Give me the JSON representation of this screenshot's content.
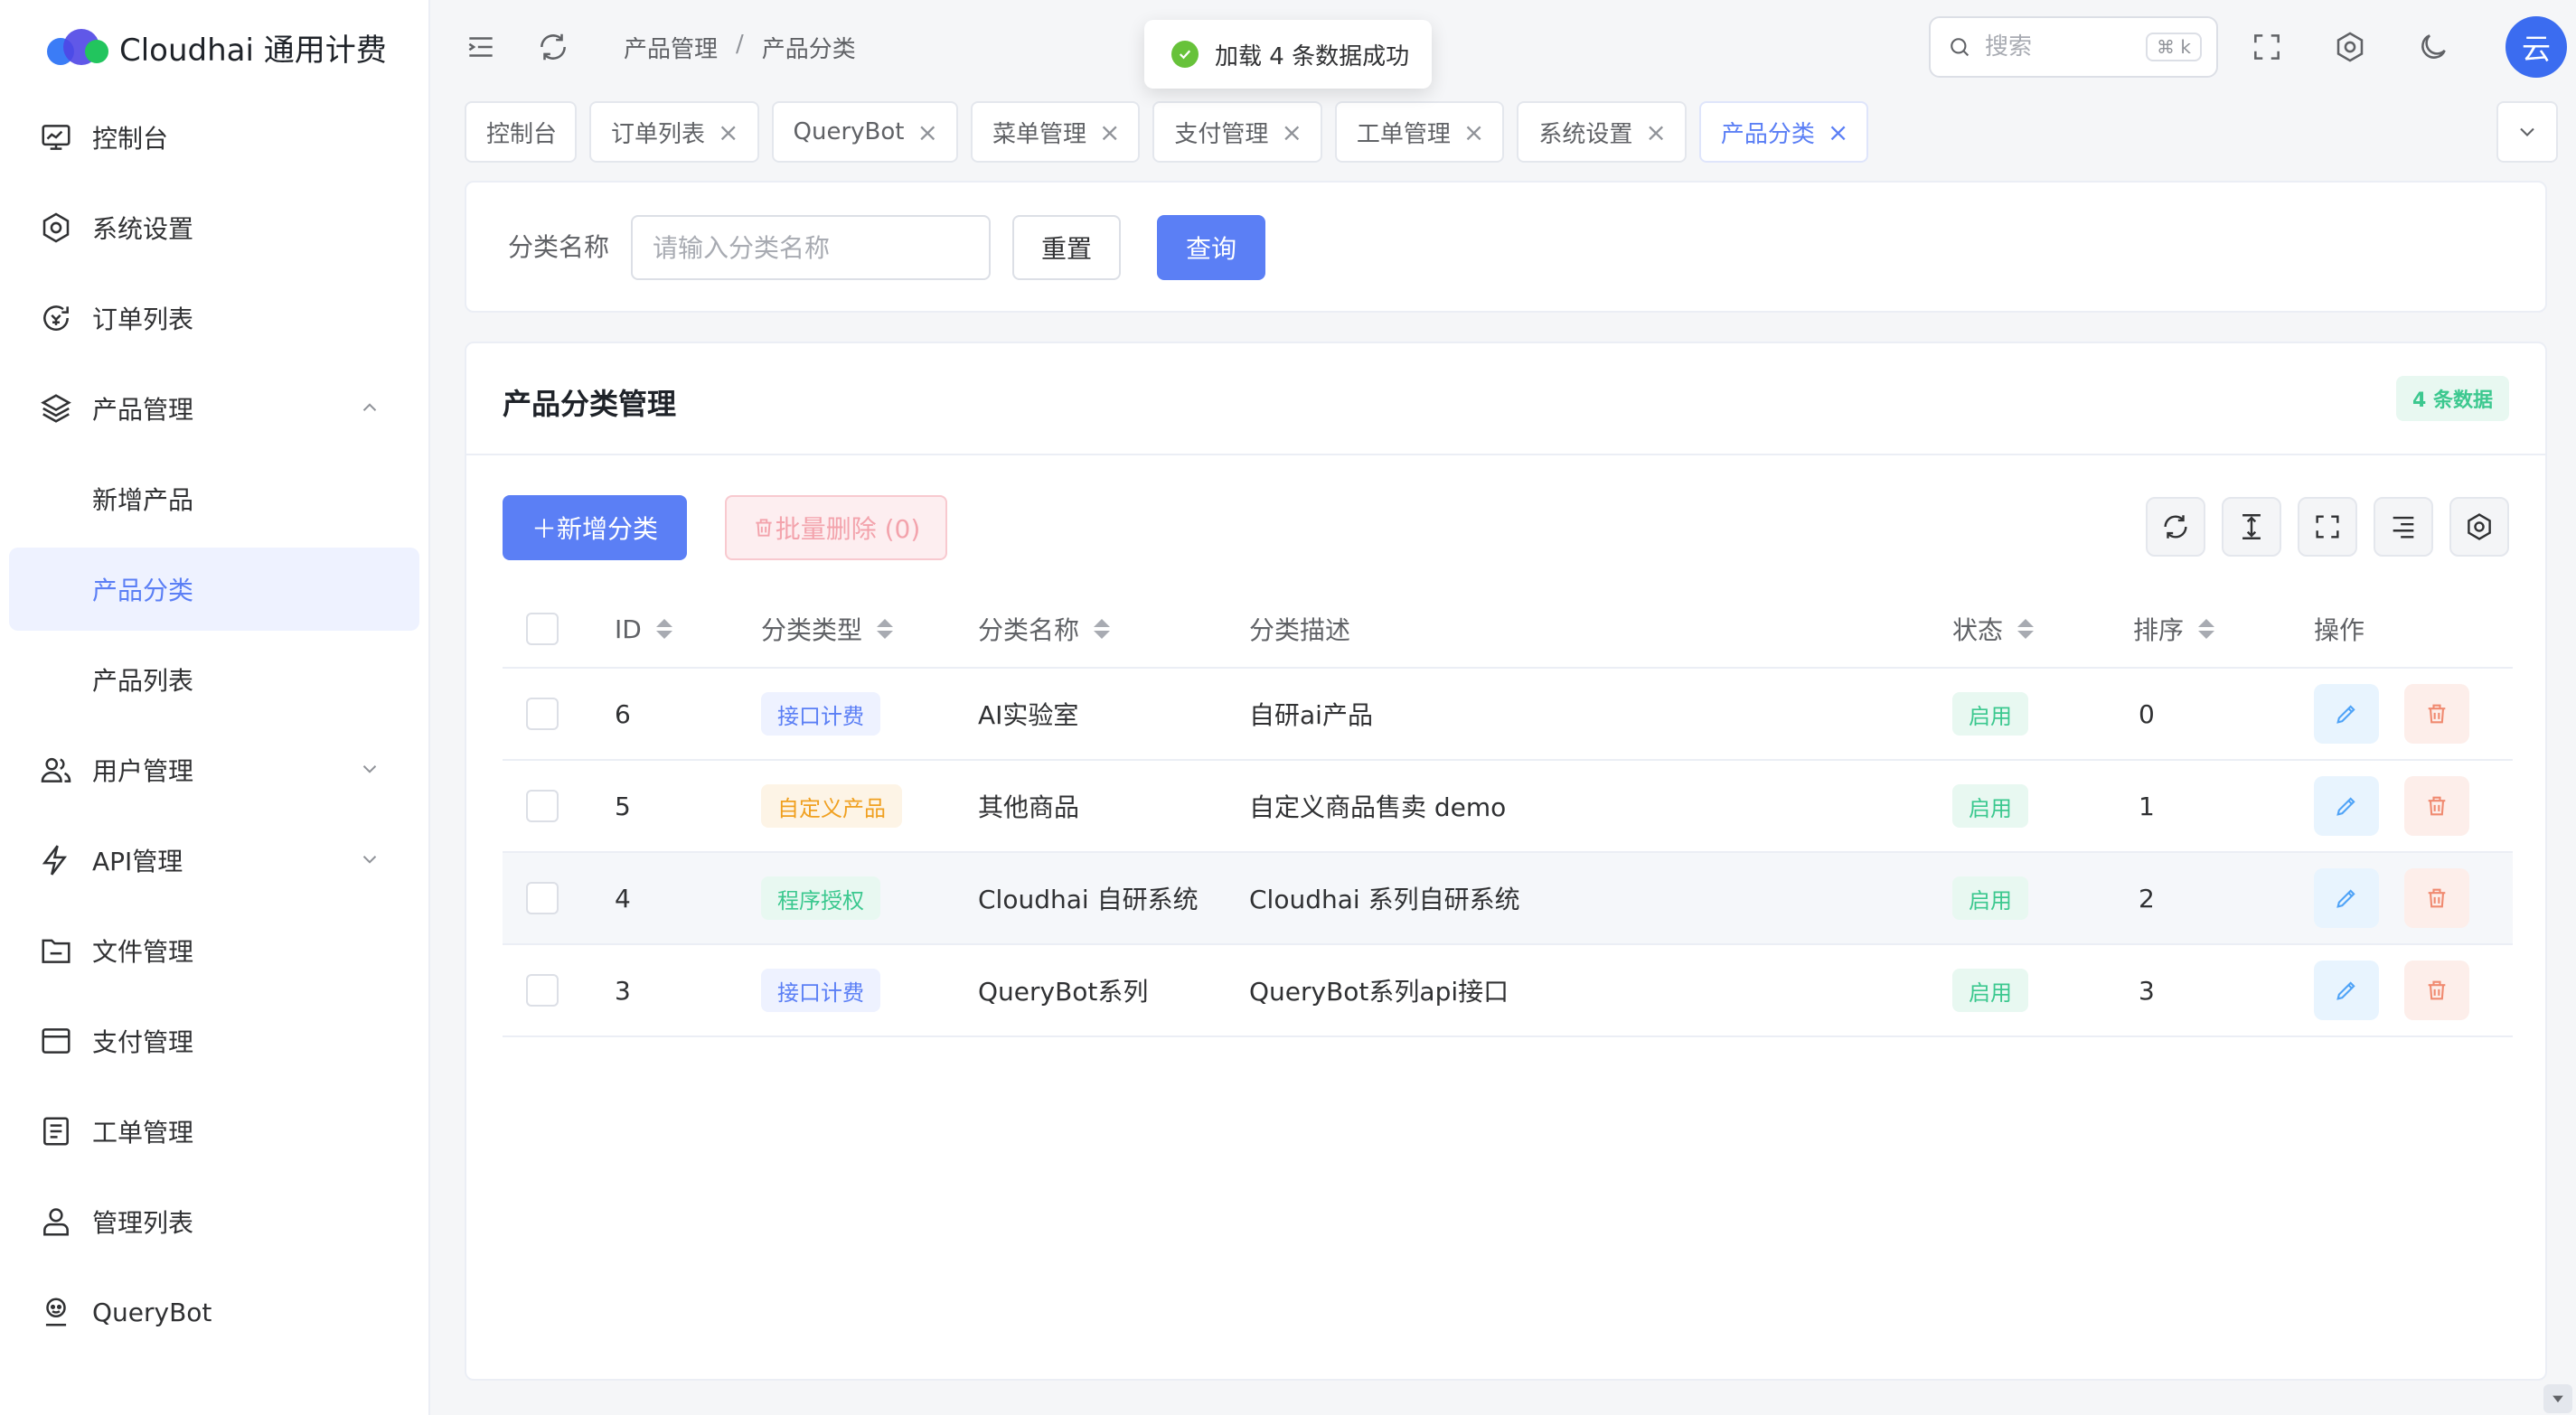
{
  "app": {
    "title": "Cloudhai 通用计费"
  },
  "sidebar": {
    "items": [
      {
        "label": "控制台",
        "icon": "dashboard-icon"
      },
      {
        "label": "系统设置",
        "icon": "settings-icon"
      },
      {
        "label": "订单列表",
        "icon": "order-icon"
      },
      {
        "label": "产品管理",
        "icon": "layers-icon",
        "expanded": true
      },
      {
        "label": "新增产品"
      },
      {
        "label": "产品分类",
        "active": true
      },
      {
        "label": "产品列表"
      },
      {
        "label": "用户管理",
        "icon": "users-icon",
        "expanded": false
      },
      {
        "label": "API管理",
        "icon": "api-icon",
        "expanded": false
      },
      {
        "label": "文件管理",
        "icon": "folder-icon"
      },
      {
        "label": "支付管理",
        "icon": "payment-icon"
      },
      {
        "label": "工单管理",
        "icon": "ticket-icon"
      },
      {
        "label": "管理列表",
        "icon": "admin-icon"
      },
      {
        "label": "QueryBot",
        "icon": "bot-icon"
      }
    ]
  },
  "header": {
    "breadcrumb": [
      "产品管理",
      "产品分类"
    ],
    "breadcrumb_sep": "/",
    "search_placeholder": "搜索",
    "search_shortcut": "⌘ k",
    "avatar_text": "云"
  },
  "toast": {
    "message": "加载 4 条数据成功"
  },
  "tabs": [
    {
      "label": "控制台",
      "closable": false
    },
    {
      "label": "订单列表",
      "closable": true
    },
    {
      "label": "QueryBot",
      "closable": true
    },
    {
      "label": "菜单管理",
      "closable": true
    },
    {
      "label": "支付管理",
      "closable": true
    },
    {
      "label": "工单管理",
      "closable": true
    },
    {
      "label": "系统设置",
      "closable": true
    },
    {
      "label": "产品分类",
      "closable": true,
      "active": true
    }
  ],
  "filter": {
    "label": "分类名称",
    "placeholder": "请输入分类名称",
    "reset_label": "重置",
    "query_label": "查询"
  },
  "card": {
    "title": "产品分类管理",
    "count_badge": "4 条数据",
    "add_label": "＋新增分类",
    "batch_delete_label": "批量删除 (0)"
  },
  "table": {
    "columns": [
      "ID",
      "分类类型",
      "分类名称",
      "分类描述",
      "状态",
      "排序",
      "操作"
    ],
    "rows": [
      {
        "id": "6",
        "type": "接口计费",
        "type_color": "blue",
        "name": "AI实验室",
        "desc": "自研ai产品",
        "status": "启用",
        "sort": "0"
      },
      {
        "id": "5",
        "type": "自定义产品",
        "type_color": "orange",
        "name": "其他商品",
        "desc": "自定义商品售卖 demo",
        "status": "启用",
        "sort": "1"
      },
      {
        "id": "4",
        "type": "程序授权",
        "type_color": "green",
        "name": "Cloudhai 自研系统",
        "desc": "Cloudhai 系列自研系统",
        "status": "启用",
        "sort": "2"
      },
      {
        "id": "3",
        "type": "接口计费",
        "type_color": "blue",
        "name": "QueryBot系列",
        "desc": "QueryBot系列api接口",
        "status": "启用",
        "sort": "3"
      }
    ]
  },
  "colors": {
    "primary": "#5b7ff5",
    "success": "#3cc88f",
    "warning": "#f0a020",
    "danger": "#f56c6c"
  }
}
